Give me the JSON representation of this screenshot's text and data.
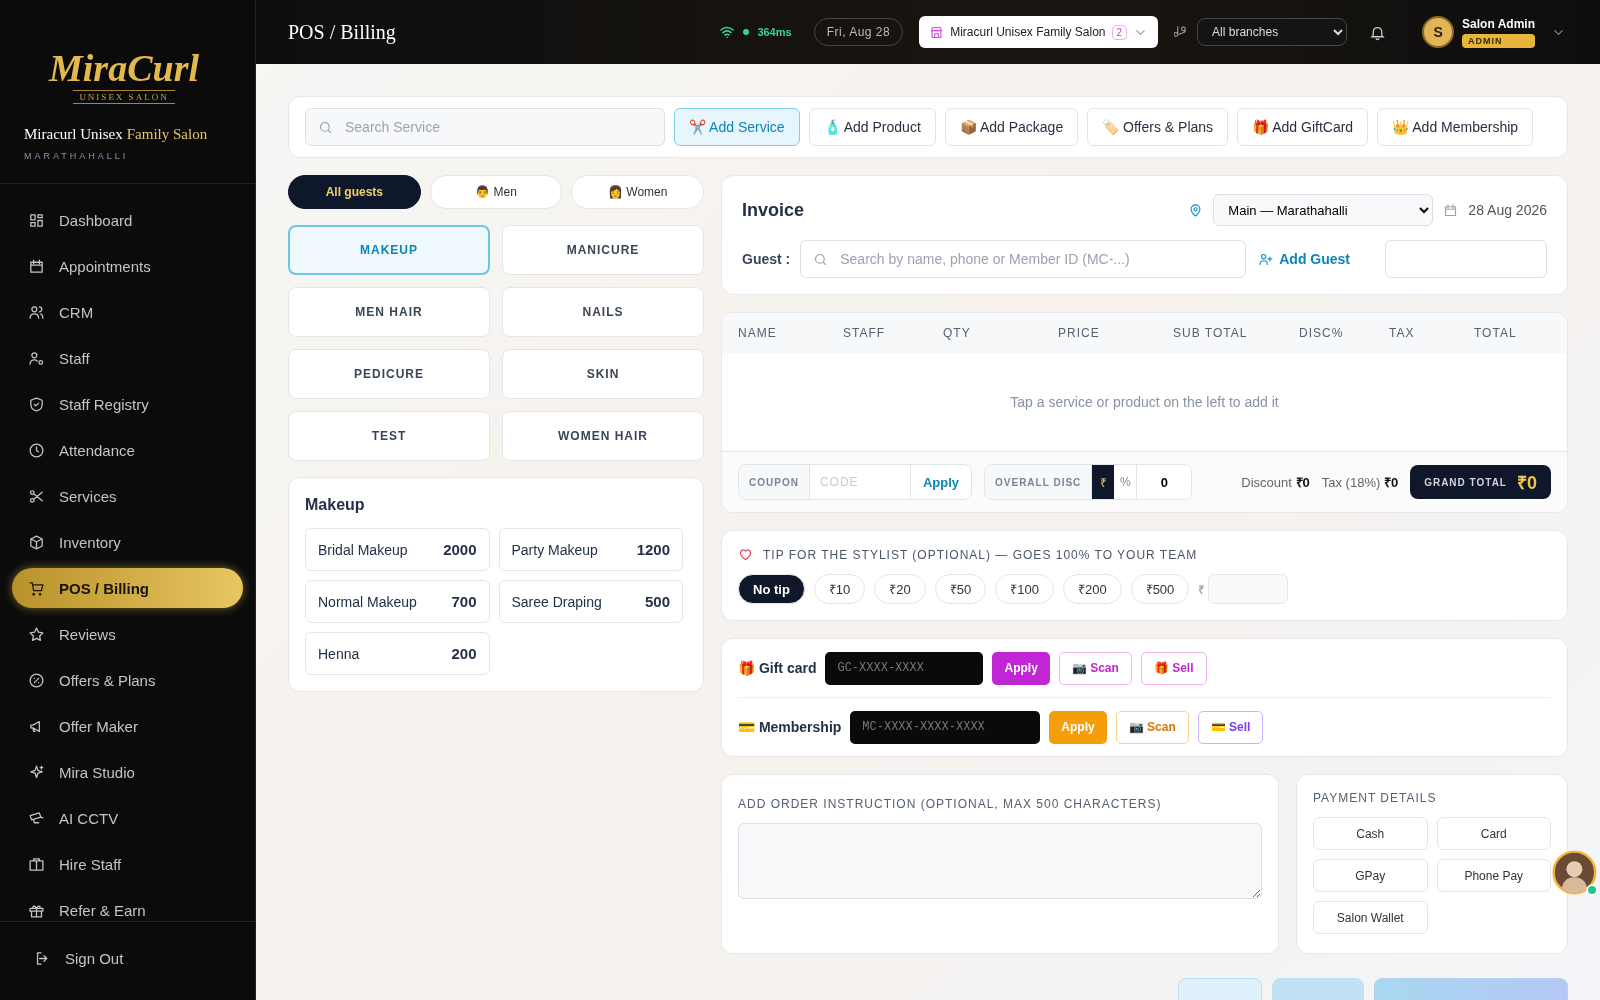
{
  "sidebar": {
    "logo": {
      "title": "MiraCurl",
      "subtitle": "UNISEX SALON"
    },
    "salon_name": {
      "plain": "Miracurl Unisex",
      "accent": "Family Salon"
    },
    "location": "MARATHAHALLI",
    "items": [
      {
        "label": "Dashboard",
        "selected": false
      },
      {
        "label": "Appointments",
        "selected": false
      },
      {
        "label": "CRM",
        "selected": false
      },
      {
        "label": "Staff",
        "selected": false
      },
      {
        "label": "Staff Registry",
        "selected": false
      },
      {
        "label": "Attendance",
        "selected": false
      },
      {
        "label": "Services",
        "selected": false
      },
      {
        "label": "Inventory",
        "selected": false
      },
      {
        "label": "POS / Billing",
        "selected": true
      },
      {
        "label": "Reviews",
        "selected": false
      },
      {
        "label": "Offers & Plans",
        "selected": false
      },
      {
        "label": "Offer Maker",
        "selected": false
      },
      {
        "label": "Mira Studio",
        "selected": false
      },
      {
        "label": "AI CCTV",
        "selected": false
      },
      {
        "label": "Hire Staff",
        "selected": false
      },
      {
        "label": "Refer & Earn",
        "selected": false
      }
    ],
    "sign_out": "Sign Out"
  },
  "header": {
    "title": "POS / Billing",
    "latency": "364ms",
    "date": "Fri, Aug 28",
    "salon_picker": {
      "label": "Miracurl Unisex Family Salon",
      "count": "2"
    },
    "branch_select": "All branches",
    "user": {
      "initial": "S",
      "name": "Salon Admin",
      "role": "ADMIN"
    }
  },
  "toolbar": {
    "search": {
      "placeholder": "Search Service"
    },
    "buttons": [
      {
        "label": "✂️ Add Service",
        "selected": true
      },
      {
        "label": "🧴 Add Product",
        "selected": false
      },
      {
        "label": "📦 Add Package",
        "selected": false
      },
      {
        "label": "🏷️ Offers & Plans",
        "selected": false
      },
      {
        "label": "🎁 Add GiftCard",
        "selected": false
      },
      {
        "label": "👑 Add Membership",
        "selected": false
      }
    ]
  },
  "guest_filters": [
    {
      "label": "All guests",
      "selected": true
    },
    {
      "label": "👨 Men",
      "selected": false
    },
    {
      "label": "👩 Women",
      "selected": false
    }
  ],
  "categories": [
    {
      "label": "MAKEUP",
      "selected": true
    },
    {
      "label": "MANICURE",
      "selected": false
    },
    {
      "label": "MEN HAIR",
      "selected": false
    },
    {
      "label": "NAILS",
      "selected": false
    },
    {
      "label": "PEDICURE",
      "selected": false
    },
    {
      "label": "SKIN",
      "selected": false
    },
    {
      "label": "TEST",
      "selected": false
    },
    {
      "label": "WOMEN HAIR",
      "selected": false
    }
  ],
  "services": {
    "title": "Makeup",
    "items": [
      {
        "name": "Bridal Makeup",
        "price": "2000"
      },
      {
        "name": "Party Makeup",
        "price": "1200"
      },
      {
        "name": "Normal Makeup",
        "price": "700"
      },
      {
        "name": "Saree Draping",
        "price": "500"
      },
      {
        "name": "Henna",
        "price": "200"
      }
    ]
  },
  "invoice": {
    "title": "Invoice",
    "branch": "Main — Marathahalli",
    "date": "28 Aug 2026",
    "guest_label": "Guest :",
    "guest_search": {
      "placeholder": "Search by name, phone or Member ID (MC-...)"
    },
    "add_guest": "Add Guest",
    "table": {
      "columns": [
        "NAME",
        "STAFF",
        "QTY",
        "PRICE",
        "SUB TOTAL",
        "DISC%",
        "TAX",
        "TOTAL"
      ],
      "empty_text": "Tap a service or product on the left to add it"
    },
    "coupon": {
      "label": "COUPON",
      "placeholder": "CODE",
      "apply": "Apply"
    },
    "overall_disc": {
      "label": "OVERALL DISC",
      "modes": [
        {
          "label": "₹",
          "selected": true
        },
        {
          "label": "%",
          "selected": false
        }
      ],
      "value": "0"
    },
    "discount": {
      "label": "Discount",
      "value": "₹0"
    },
    "tax": {
      "label": "Tax (18%)",
      "value": "₹0"
    },
    "grand_total": {
      "label": "GRAND TOTAL",
      "value": "₹0"
    }
  },
  "tip": {
    "title": "TIP FOR THE STYLIST (OPTIONAL) — GOES 100% TO YOUR TEAM",
    "options": [
      {
        "label": "No tip",
        "selected": true
      },
      {
        "label": "₹10",
        "selected": false
      },
      {
        "label": "₹20",
        "selected": false
      },
      {
        "label": "₹50",
        "selected": false
      },
      {
        "label": "₹100",
        "selected": false
      },
      {
        "label": "₹200",
        "selected": false
      },
      {
        "label": "₹500",
        "selected": false
      }
    ],
    "currency": "₹"
  },
  "codes": [
    {
      "kind": "gift",
      "label": "🎁 Gift card",
      "placeholder": "GC-XXXX-XXXX",
      "apply": "Apply",
      "scan": "📷 Scan",
      "sell": "🎁 Sell"
    },
    {
      "kind": "membership",
      "label": "💳 Membership",
      "placeholder": "MC-XXXX-XXXX-XXXX",
      "apply": "Apply",
      "scan": "📷 Scan",
      "sell": "💳 Sell"
    }
  ],
  "instruction": {
    "label": "ADD ORDER INSTRUCTION (OPTIONAL, MAX 500 CHARACTERS)"
  },
  "payment": {
    "title": "PAYMENT DETAILS",
    "methods": [
      "Cash",
      "Card",
      "GPay",
      "Phone Pay",
      "Salon Wallet"
    ]
  }
}
